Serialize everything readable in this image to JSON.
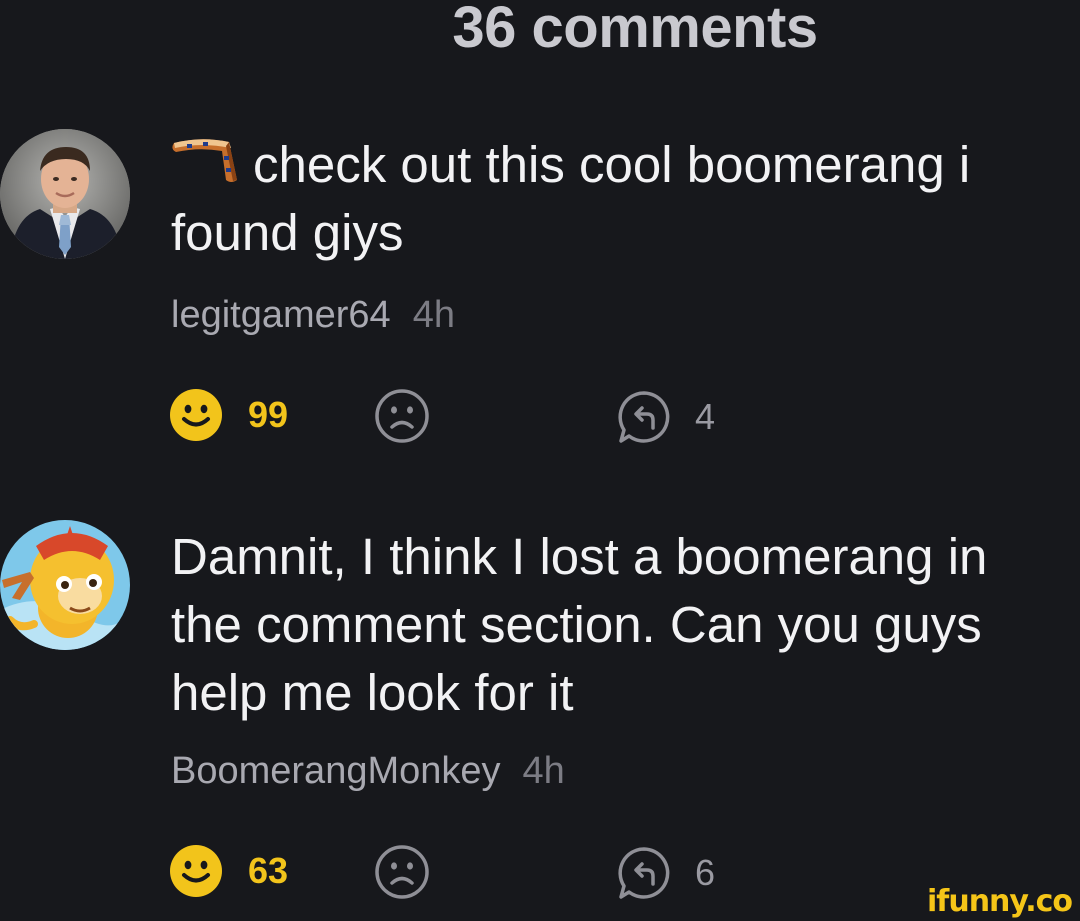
{
  "header": {
    "title": "36 comments"
  },
  "comments": [
    {
      "avatar": "avatar-man-in-suit",
      "prefix_icon": "boomerang-icon",
      "lines": [
        "check out this cool boomerang i",
        "found giys"
      ],
      "username": "legitgamer64",
      "time": "4h",
      "smiles": "99",
      "replies": "4"
    },
    {
      "avatar": "avatar-boomerang-monkey",
      "lines": [
        "Damnit, I think I lost a boomerang in",
        "the comment section. Can you guys",
        "help me look for it"
      ],
      "username": "BoomerangMonkey",
      "time": "4h",
      "smiles": "63",
      "replies": "6"
    }
  ],
  "colors": {
    "background": "#17181c",
    "smile_yellow": "#f2c41b",
    "icon_gray": "#8f8f96"
  },
  "watermark": "ifunny.co"
}
